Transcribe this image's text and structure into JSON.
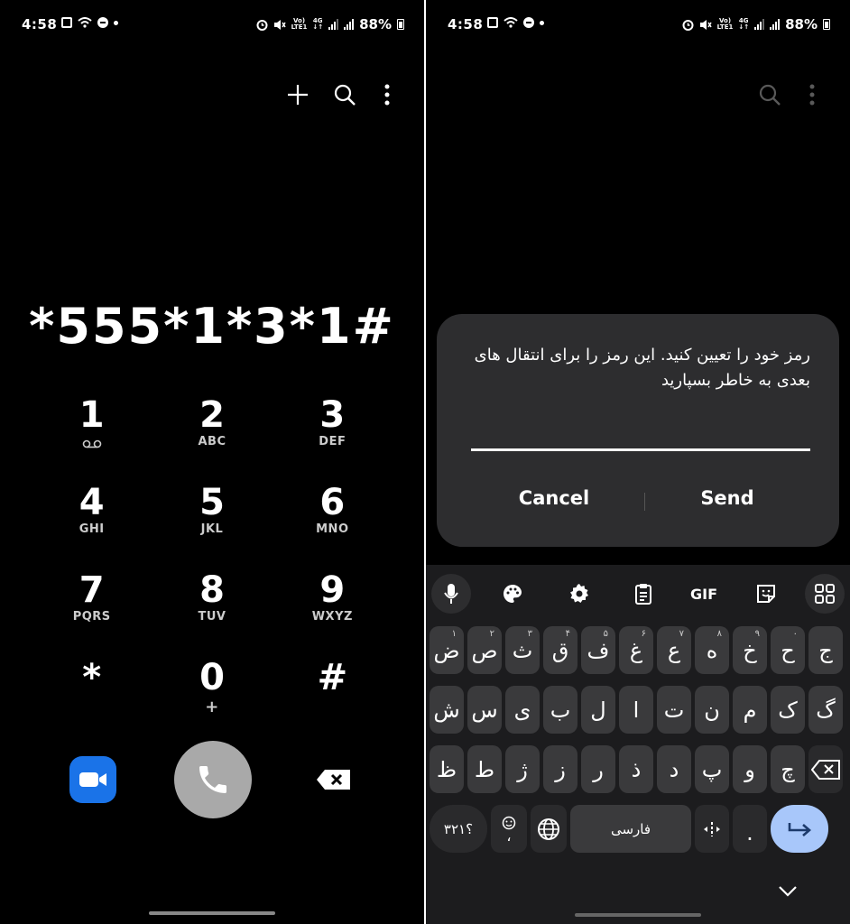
{
  "status": {
    "time": "4:58",
    "battery": "88%",
    "net_top": "Vo)",
    "net_bottom": "LTE1",
    "gen": "4G"
  },
  "dialer": {
    "number": "*555*1*3*1#",
    "keys": [
      {
        "digit": "1",
        "letters": ""
      },
      {
        "digit": "2",
        "letters": "ABC"
      },
      {
        "digit": "3",
        "letters": "DEF"
      },
      {
        "digit": "4",
        "letters": "GHI"
      },
      {
        "digit": "5",
        "letters": "JKL"
      },
      {
        "digit": "6",
        "letters": "MNO"
      },
      {
        "digit": "7",
        "letters": "PQRS"
      },
      {
        "digit": "8",
        "letters": "TUV"
      },
      {
        "digit": "9",
        "letters": "WXYZ"
      },
      {
        "digit": "*",
        "letters": ""
      },
      {
        "digit": "0",
        "letters": "+"
      },
      {
        "digit": "#",
        "letters": ""
      }
    ],
    "colors": {
      "video": "#1a73e8",
      "call": "#a9a9a9"
    }
  },
  "dialog": {
    "message": "رمز خود را تعیین کنید. این رمز را برای انتقال های بعدی به خاطر بسپارید",
    "cancel_label": "Cancel",
    "send_label": "Send"
  },
  "keyboard": {
    "toolbar_gif": "GIF",
    "row1": [
      {
        "ch": "ض",
        "hint": "۱"
      },
      {
        "ch": "ص",
        "hint": "۲"
      },
      {
        "ch": "ث",
        "hint": "۳"
      },
      {
        "ch": "ق",
        "hint": "۴"
      },
      {
        "ch": "ف",
        "hint": "۵"
      },
      {
        "ch": "غ",
        "hint": "۶"
      },
      {
        "ch": "ع",
        "hint": "۷"
      },
      {
        "ch": "ه",
        "hint": "۸"
      },
      {
        "ch": "خ",
        "hint": "۹"
      },
      {
        "ch": "ح",
        "hint": "۰"
      },
      {
        "ch": "ج",
        "hint": ""
      }
    ],
    "row2": [
      "ش",
      "س",
      "ی",
      "ب",
      "ل",
      "ا",
      "ت",
      "ن",
      "م",
      "ک",
      "گ"
    ],
    "row3": [
      "ظ",
      "ط",
      "ژ",
      "ز",
      "ر",
      "ذ",
      "د",
      "پ",
      "و",
      "چ"
    ],
    "numbers_label": "؟۳۲۱",
    "comma_label": "،",
    "space_label": "فارسی",
    "period_label": ".",
    "enter_color": "#a8c7fa"
  }
}
